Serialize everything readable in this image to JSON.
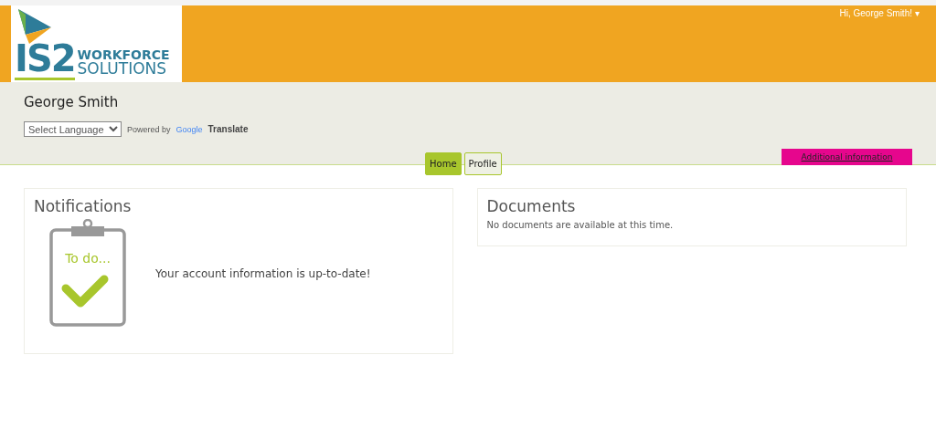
{
  "logo": {
    "mark": "IS2",
    "line1": "WORKFORCE",
    "line2": "SOLUTIONS"
  },
  "user_menu": {
    "label": "Hi, George Smith!",
    "caret": "▾"
  },
  "profile": {
    "name": "George Smith"
  },
  "language": {
    "select": "Select Language",
    "powered_by": "Powered by",
    "google": "Google",
    "translate": "Translate"
  },
  "tabs": [
    {
      "label": "Home",
      "selected": true
    },
    {
      "label": "Profile",
      "selected": false
    }
  ],
  "additional_link": "Additional information",
  "notifications": {
    "title": "Notifications",
    "clipboard_text": "To do...",
    "message": "Your account information is up-to-date!"
  },
  "documents": {
    "title": "Documents",
    "message": "No documents are available at this time."
  }
}
